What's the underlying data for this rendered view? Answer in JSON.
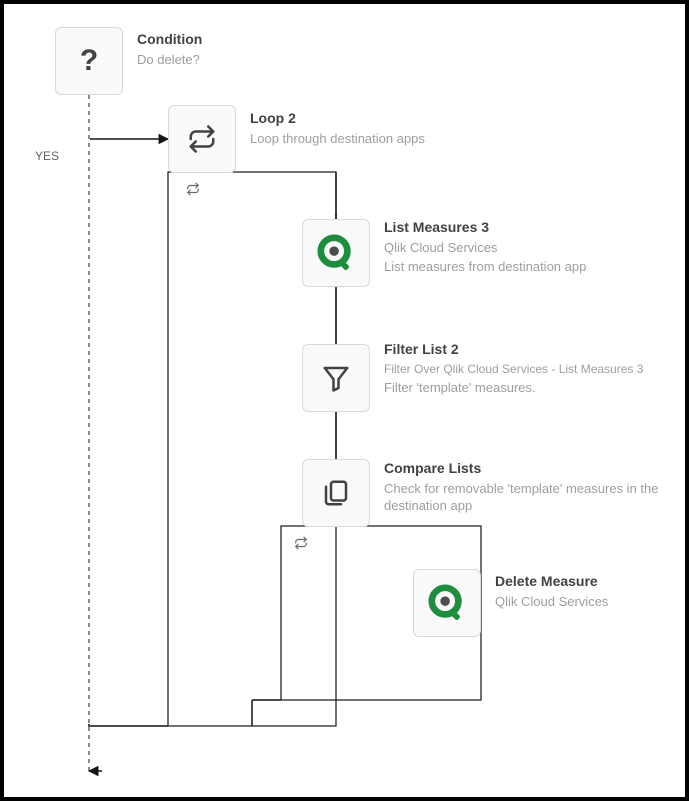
{
  "condition": {
    "title": "Condition",
    "subtitle": "Do delete?",
    "yes_label": "YES"
  },
  "loop2": {
    "title": "Loop 2",
    "subtitle": "Loop through destination apps"
  },
  "listMeasures": {
    "title": "List Measures 3",
    "subtitle": "Qlik Cloud Services",
    "description": "List measures from destination app"
  },
  "filterList": {
    "title": "Filter List 2",
    "subtitle": "Filter Over Qlik Cloud Services - List Measures 3",
    "description": "Filter 'template' measures."
  },
  "compareLists": {
    "title": "Compare Lists",
    "subtitle": "Check for removable 'template' measures in the destination app"
  },
  "deleteMeasure": {
    "title": "Delete Measure",
    "subtitle": "Qlik Cloud Services"
  }
}
